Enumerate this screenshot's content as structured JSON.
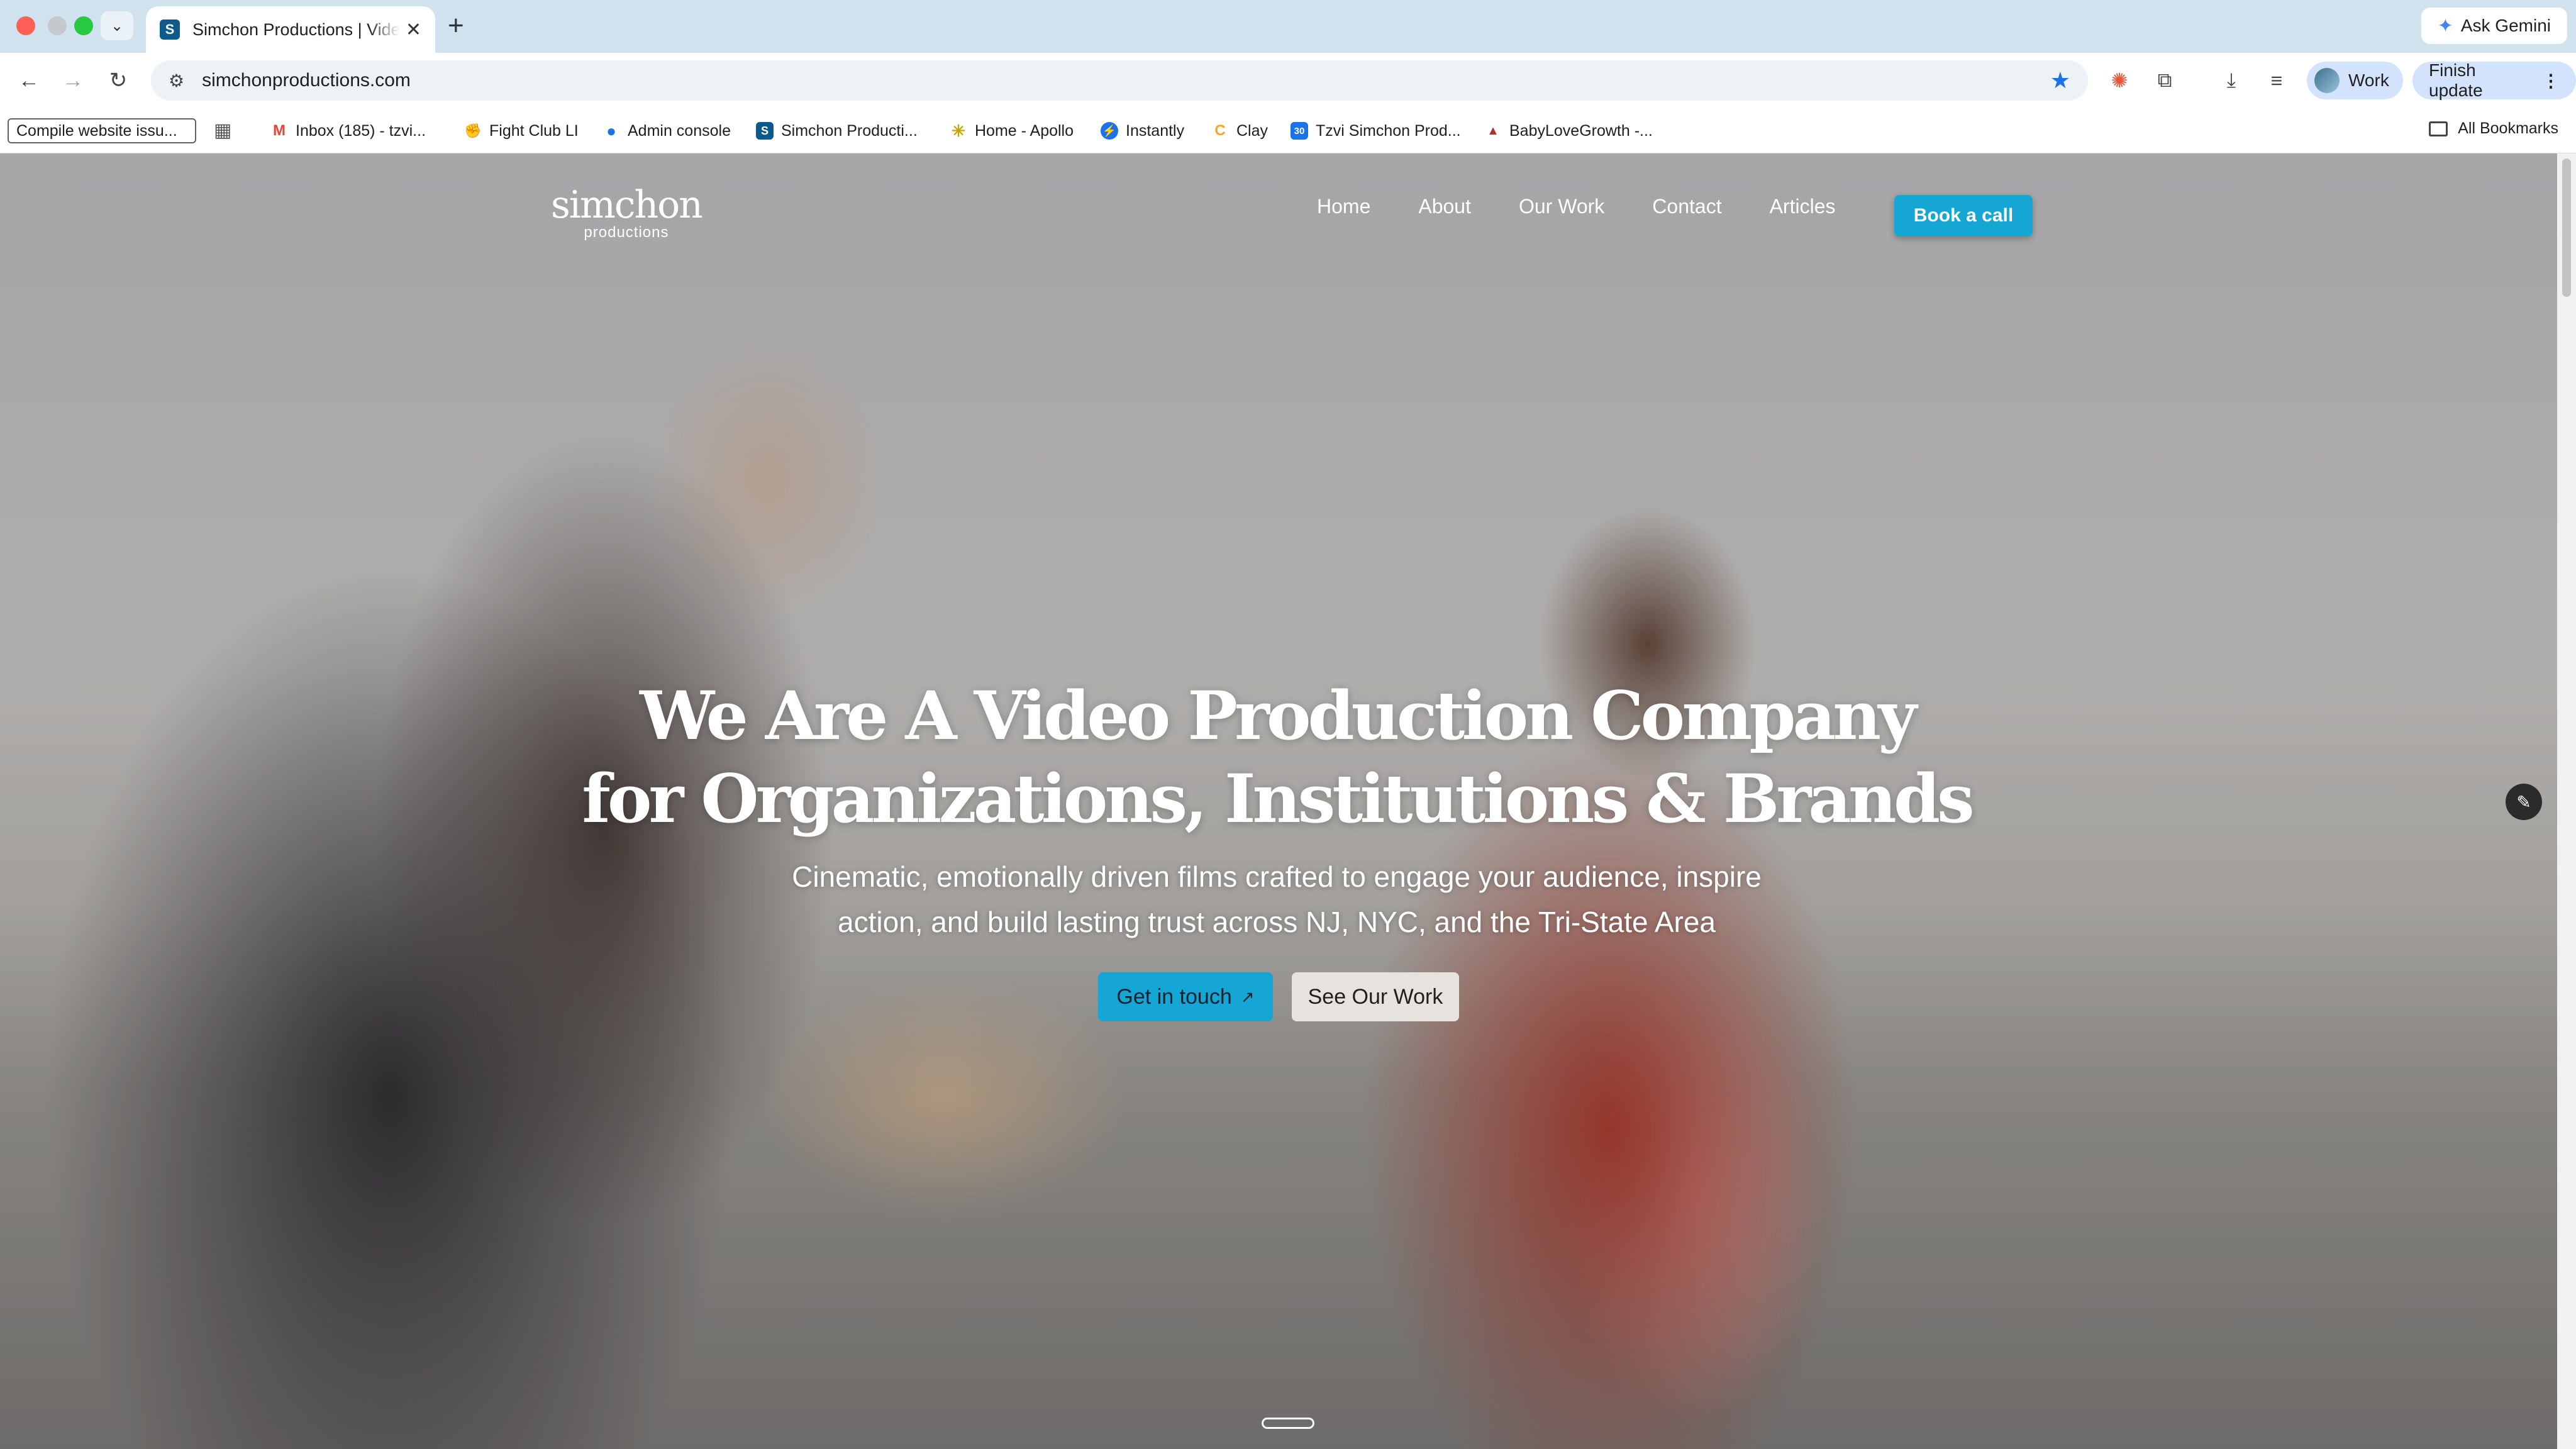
{
  "browser": {
    "tab": {
      "favicon_letter": "S",
      "title": "Simchon Productions | Video Production",
      "close": "✕"
    },
    "new_tab": "+",
    "ask_gemini": "Ask Gemini",
    "url": "simchonproductions.com",
    "profile": "Work",
    "finish_update": "Finish update"
  },
  "bookmarks": {
    "first": "Compile website issu...",
    "items": [
      {
        "label": "Inbox (185) - tzvi...",
        "icon": "gmail-icon",
        "glyph": "M",
        "color": "#ea4335"
      },
      {
        "label": "Fight Club LI",
        "icon": "fight-club-icon",
        "glyph": "✊",
        "color": "#555555"
      },
      {
        "label": "Admin console",
        "icon": "admin-console-icon",
        "glyph": "●",
        "color": "#1a73e8"
      },
      {
        "label": "Simchon Producti...",
        "icon": "simchon-icon",
        "glyph": "S",
        "color": "#0f5a8c"
      },
      {
        "label": "Home - Apollo",
        "icon": "apollo-icon",
        "glyph": "✳",
        "color": "#e8c21a"
      },
      {
        "label": "Instantly",
        "icon": "instantly-icon",
        "glyph": "⚡",
        "color": "#1a73e8"
      },
      {
        "label": "Clay",
        "icon": "clay-icon",
        "glyph": "C",
        "color": "#f5a623"
      },
      {
        "label": "Tzvi Simchon Prod...",
        "icon": "calendar-icon",
        "glyph": "30",
        "color": "#1a73e8"
      },
      {
        "label": "BabyLoveGrowth -...",
        "icon": "babylove-icon",
        "glyph": "▲",
        "color": "#b0302b"
      }
    ],
    "all": "All Bookmarks"
  },
  "site": {
    "logo_main": "simchon",
    "logo_sub": "productions",
    "nav": [
      "Home",
      "About",
      "Our Work",
      "Contact",
      "Articles"
    ],
    "cta": "Book a call",
    "hero_title_line1": "We Are A Video Production Company",
    "hero_title_line2": "for Organizations, Institutions & Brands",
    "hero_sub_line1": "Cinematic, emotionally driven films crafted to engage your audience, inspire",
    "hero_sub_line2": "action, and build lasting trust across NJ, NYC, and the Tri-State Area",
    "btn_touch": "Get in touch",
    "btn_work": "See Our Work"
  }
}
